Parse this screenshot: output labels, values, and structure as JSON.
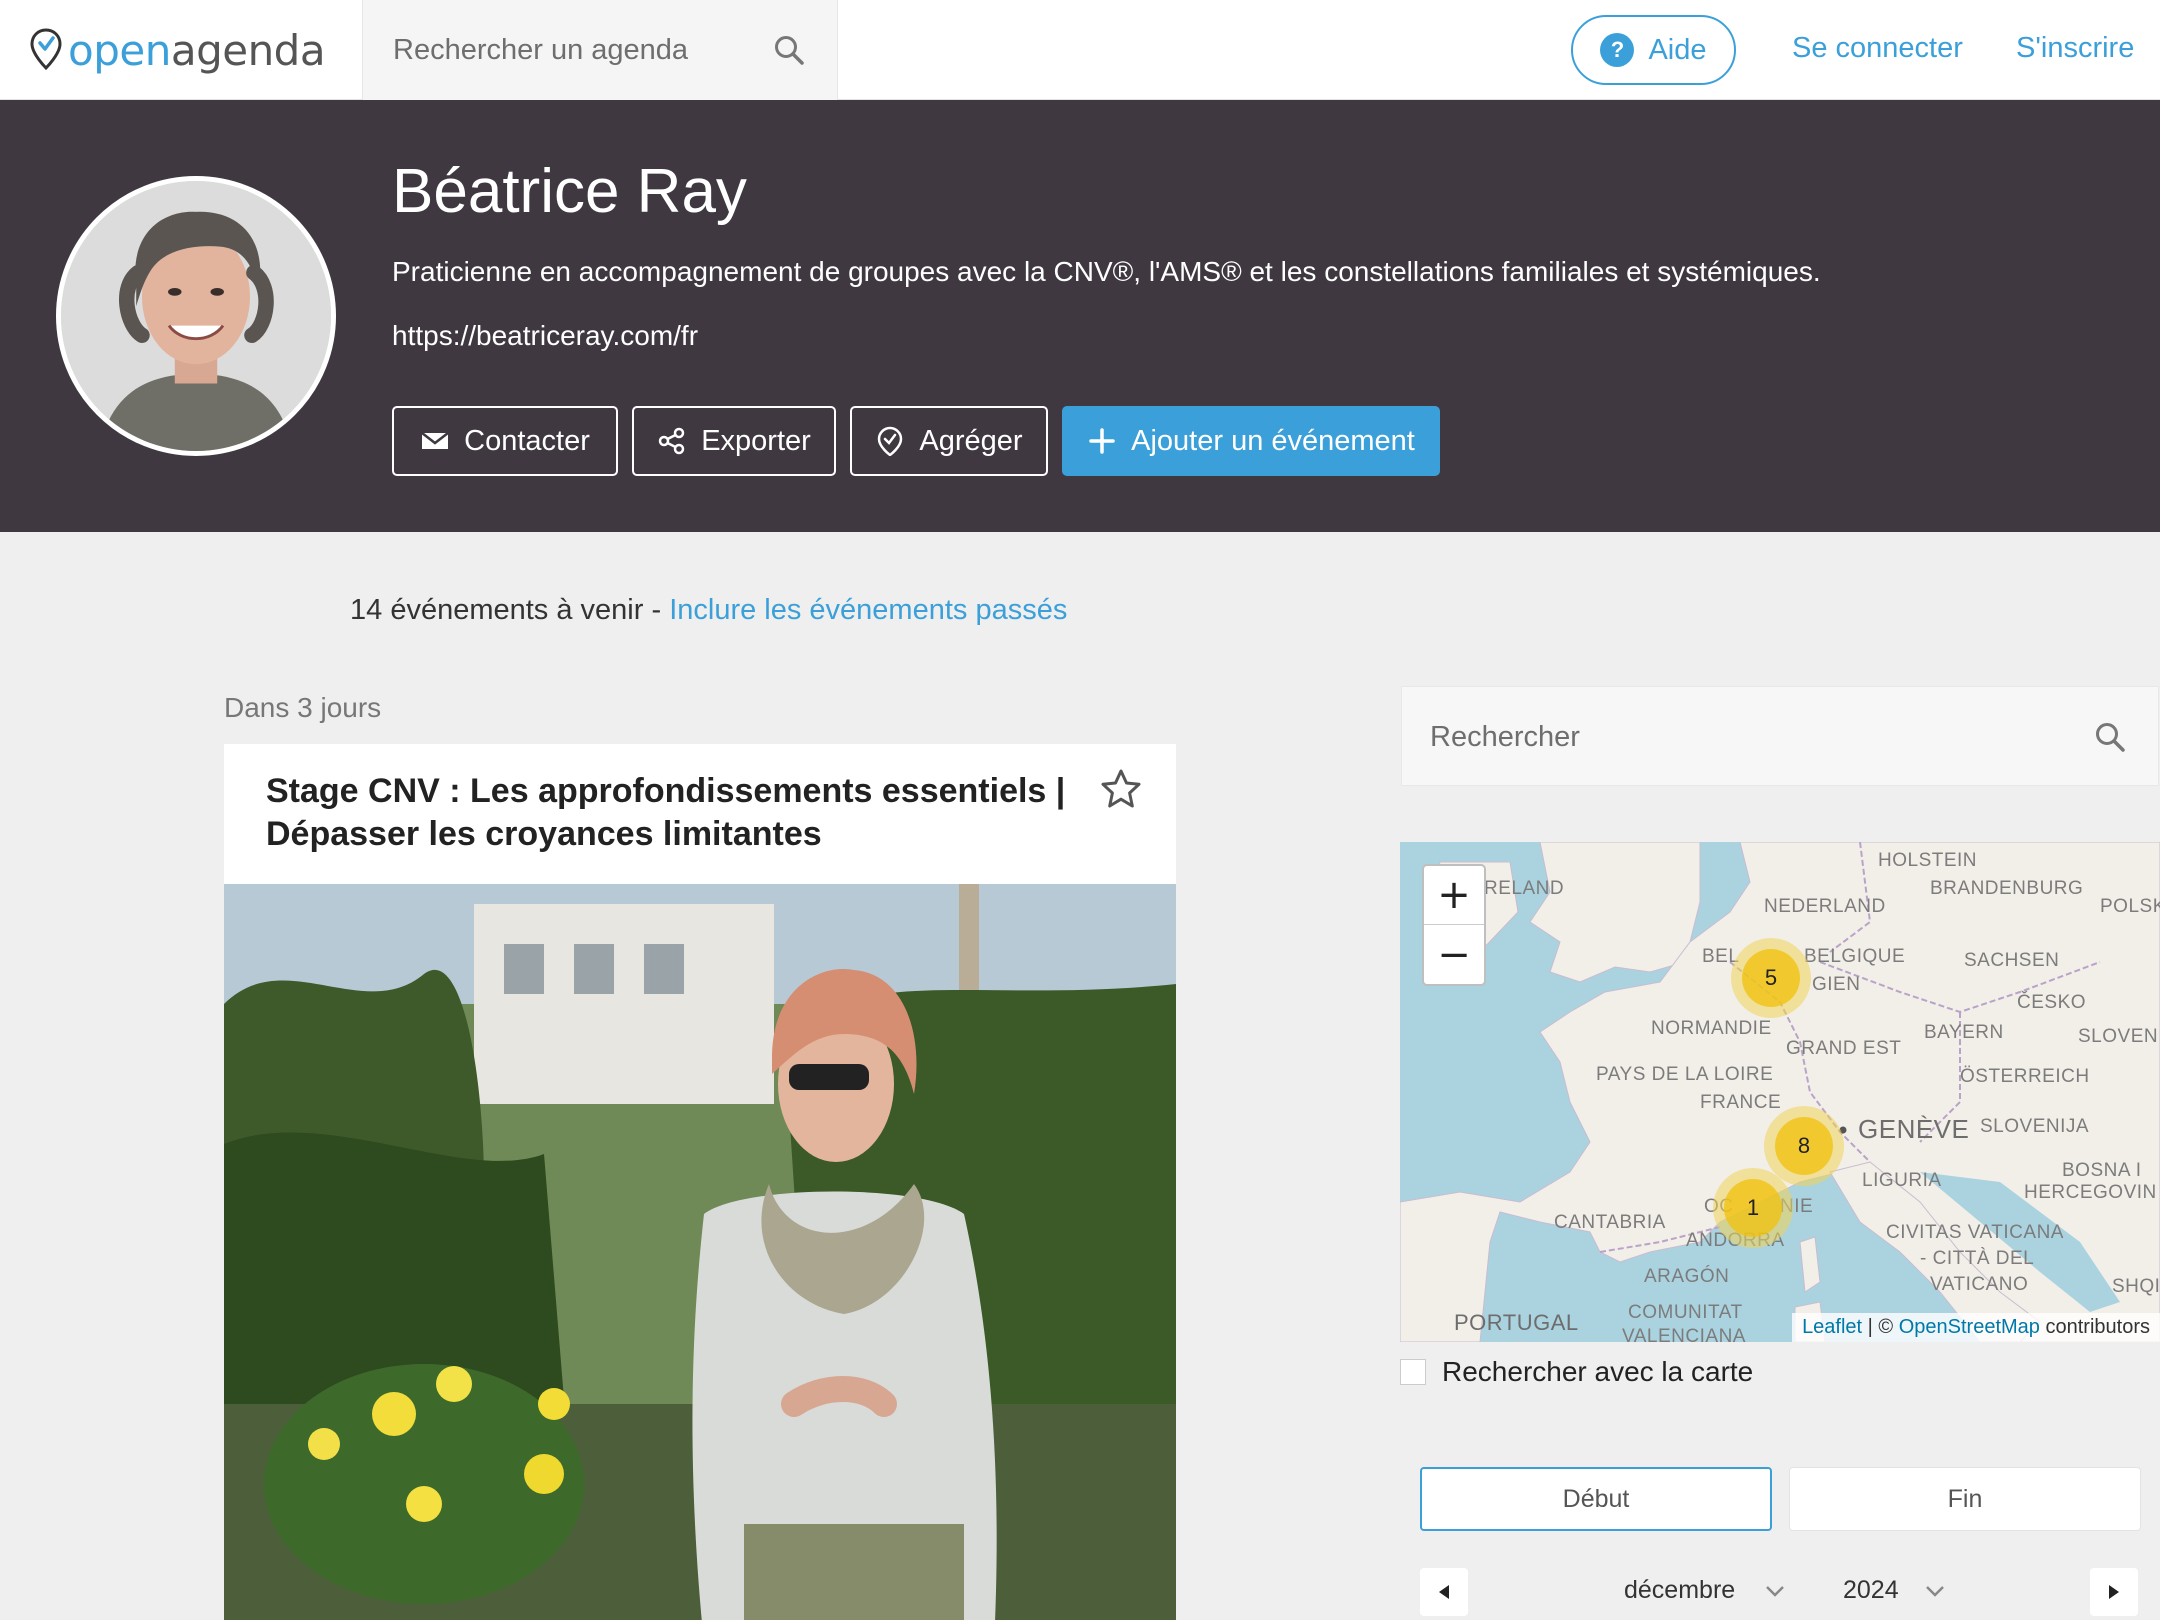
{
  "nav": {
    "logo_open": "open",
    "logo_agenda": "agenda",
    "search_placeholder": "Rechercher un agenda",
    "help_label": "Aide",
    "login_label": "Se connecter",
    "signup_label": "S'inscrire"
  },
  "agenda": {
    "title": "Béatrice Ray",
    "description": "Praticienne en accompagnement de groupes avec la CNV®, l'AMS® et les constellations familiales et systémiques.",
    "url": "https://beatriceray.com/fr",
    "buttons": {
      "contact": "Contacter",
      "export": "Exporter",
      "aggregate": "Agréger",
      "add_event": "Ajouter un événement"
    }
  },
  "events": {
    "count_text": "14 événements à venir -",
    "include_past_label": "Inclure les événements passés",
    "group_label": "Dans 3 jours",
    "items": [
      {
        "title": "Stage CNV : Les approfondissements essentiels | Dépasser les croyances limitantes"
      }
    ]
  },
  "sidebar": {
    "search_placeholder": "Rechercher",
    "map": {
      "zoom_in": "+",
      "zoom_out": "−",
      "clusters": [
        {
          "count": "5"
        },
        {
          "count": "8"
        },
        {
          "count": "1"
        }
      ],
      "labels": {
        "holstein": "HOLSTEIN",
        "ireland": "RELAND",
        "brandenburg": "BRANDENBURG",
        "polska": "POLSK",
        "nederland": "NEDERLAND",
        "belgique": "BELGIQUE",
        "belgie": "BEL",
        "belgien": "GIEN",
        "sachsen": "SACHSEN",
        "cesko": "ČESKO",
        "normandie": "NORMANDIE",
        "bayern": "BAYERN",
        "slovenija_top": "SLOVEN",
        "grand_est": "GRAND EST",
        "pays_de_la_loire": "PAYS DE LA LOIRE",
        "osterreich": "ÖSTERREICH",
        "france": "FRANCE",
        "geneve": "GENÈVE",
        "slovenija": "SLOVENIJA",
        "liguria": "LIGURIA",
        "bosna": "BOSNA I",
        "hercegovina": "HERCEGOVIN",
        "occitanie_a": "OC",
        "occitanie_b": "NIE",
        "cantabria": "CANTABRIA",
        "andorra": "ANDORRA",
        "vaticana_1": "CIVITAS VATICANA",
        "vaticana_2": "- CITTÀ DEL",
        "vaticana_3": "VATICANO",
        "aragon": "ARAGÓN",
        "shqip": "SHQIP",
        "portugal": "PORTUGAL",
        "comunitat": "COMUNITAT",
        "valenciana": "VALENCIANA"
      },
      "attribution_leaflet": "Leaflet",
      "attribution_sep": " | © ",
      "attribution_osm": "OpenStreetMap",
      "attribution_tail": " contributors"
    },
    "map_search_label": "Rechercher avec la carte",
    "date_start_label": "Début",
    "date_end_label": "Fin",
    "calendar_month": "décembre",
    "calendar_year": "2024"
  },
  "colors": {
    "accent": "#3ba0d9",
    "header_bg": "#3f3841",
    "page_bg": "#efefef",
    "cluster": "#f0c20c"
  },
  "icons": {
    "search": "search-icon",
    "help": "question-icon",
    "mail": "envelope-icon",
    "share": "share-icon",
    "pin": "map-pin-icon",
    "plus": "plus-icon",
    "star": "star-outline-icon"
  }
}
